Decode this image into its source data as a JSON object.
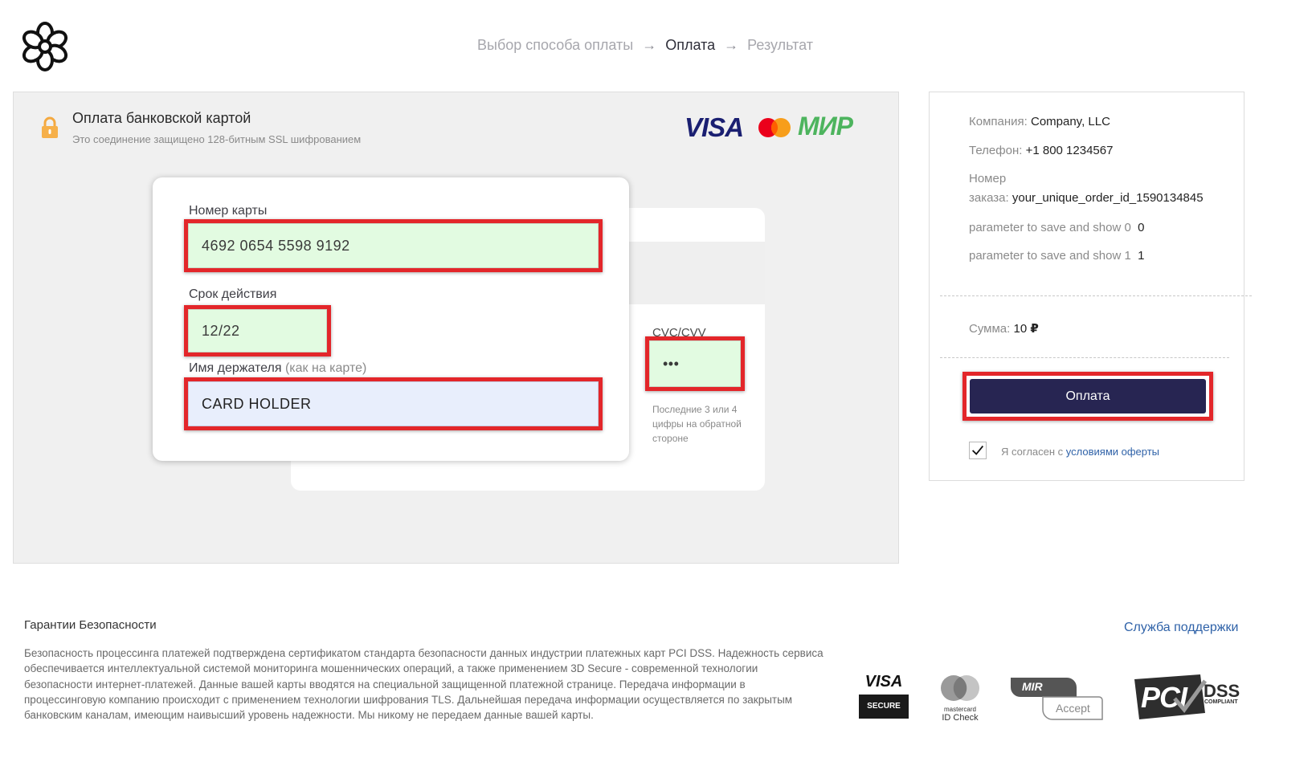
{
  "header": {
    "steps": [
      "Выбор способа оплаты",
      "Оплата",
      "Результат"
    ],
    "arrow": "→",
    "active_step": 1
  },
  "payment": {
    "title": "Оплата банковской картой",
    "subtitle": "Это соединение защищено 128-битным SSL шифрованием",
    "brands": {
      "visa": "VISA",
      "mir": "МИР"
    }
  },
  "card": {
    "number_label": "Номер карты",
    "number_value": "4692 0654 5598 9192",
    "expiry_label": "Срок действия",
    "expiry_value": "12/22",
    "holder_label": "Имя держателя",
    "holder_label_hint": "(как на карте)",
    "holder_value": "CARD HOLDER",
    "cvc_label": "CVC/CVV",
    "cvc_value": "•••",
    "cvc_hint": "Последние 3 или 4 цифры на обратной стороне"
  },
  "summary": {
    "company_key": "Компания:",
    "company_value": "Company, LLC",
    "phone_key": "Телефон:",
    "phone_value": "+1 800 1234567",
    "order_key_line1": "Номер",
    "order_key_line2": "заказа:",
    "order_value": "your_unique_order_id_1590134845",
    "param0_key": "parameter to save and show 0",
    "param0_value": "0",
    "param1_key": "parameter to save and show 1",
    "param1_value": "1",
    "sum_key": "Сумма:",
    "sum_value": "10",
    "currency": "₽",
    "pay_button": "Оплата",
    "agree_text": "Я согласен с",
    "agree_link": "условиями оферты"
  },
  "footer": {
    "title": "Гарантии Безопасности",
    "support_link": "Служба поддержки",
    "text": "Безопасность процессинга платежей подтверждена сертификатом стандарта безопасности данных индустрии платежных карт PCI DSS. Надежность сервиса обеспечивается интеллектуальной системой мониторинга мошеннических операций, а также применением 3D Secure - современной технологии безопасности интернет-платежей. Данные вашей карты вводятся на специальной защищенной платежной странице. Передача информации в процессинговую компанию происходит с применением технологии шифрования TLS. Дальнейшая передача информации осуществляется по закрытым банковским каналам, имеющим наивысший уровень надежности. Мы никому не передаем данные вашей карты.",
    "badges": {
      "visa_secure_top": "VISA",
      "visa_secure_bottom": "SECURE",
      "mc_top": "mastercard",
      "mc_bottom": "ID Check",
      "mir_top": "MIR",
      "mir_bottom": "Accept",
      "pci_main": "PCI",
      "pci_dss": "DSS",
      "pci_compliant": "COMPLIANT"
    }
  },
  "colors": {
    "highlight": "#e3262a",
    "pay_button": "#272552",
    "link": "#2f62a8",
    "field_green": "#e2fbe1",
    "field_blue": "#e8eefc"
  }
}
